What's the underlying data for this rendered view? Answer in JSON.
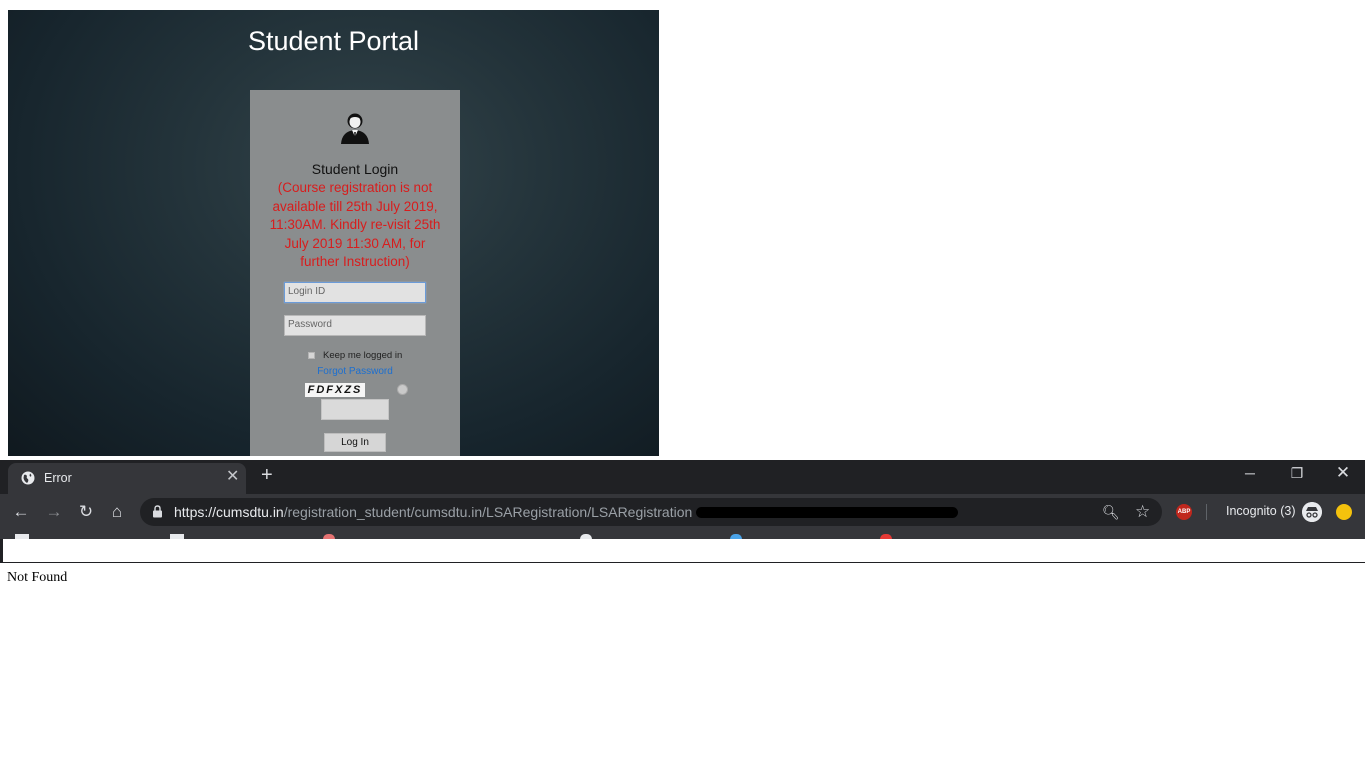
{
  "portal": {
    "title": "Student Portal",
    "login_heading": "Student Login",
    "notice": "(Course registration is not available till 25th July 2019, 11:30AM. Kindly re-visit 25th July 2019 11:30 AM, for further Instruction)",
    "login_id_placeholder": "Login ID",
    "password_placeholder": "Password",
    "remember_label": "Keep me logged in",
    "forgot_label": "Forgot Password",
    "captcha_text": "FDFXZS",
    "login_button": "Log In"
  },
  "browser": {
    "tab_title": "Error",
    "url_host": "https://cumsdtu.in",
    "url_path": "/registration_student/cumsdtu.in/LSARegistration/LSARegistration",
    "incognito_label": "Incognito (3)",
    "abp_label": "ABP"
  },
  "page": {
    "body_text": "Not Found"
  },
  "colors": {
    "notice_red": "#d81d1d",
    "link_blue": "#1c6fd0",
    "chrome_dark": "#202124",
    "chrome_toolbar": "#35363a"
  }
}
